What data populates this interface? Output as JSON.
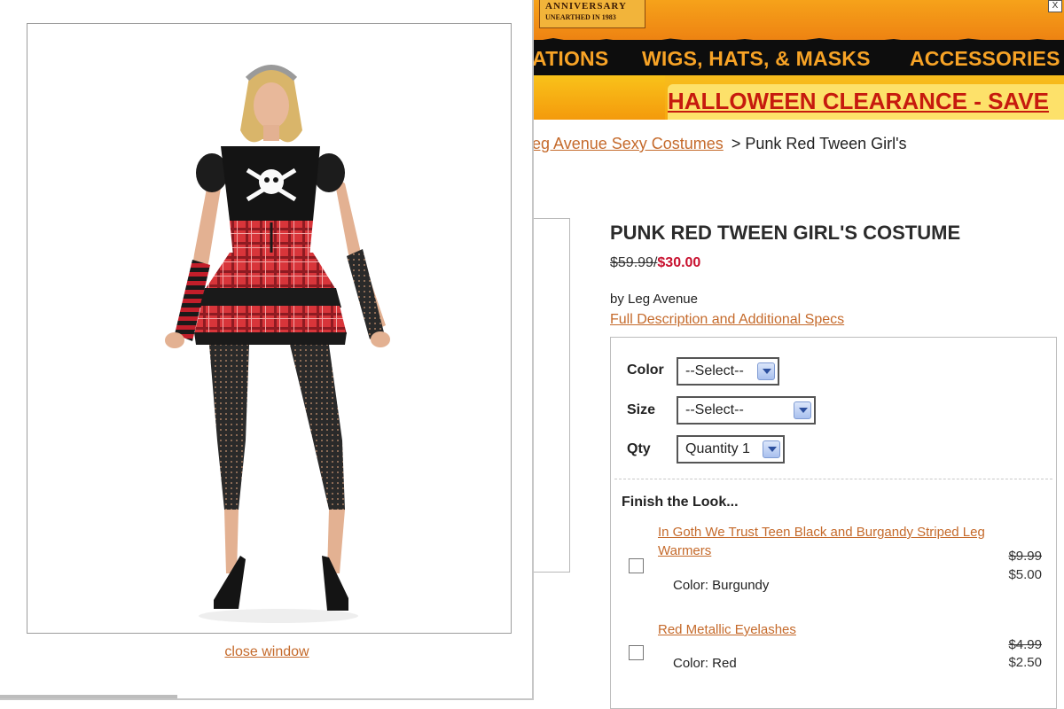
{
  "header": {
    "logo_line1": "ANNIVERSARY",
    "logo_line2": "UNEARTHED IN 1983",
    "close_glyph": "X"
  },
  "nav": {
    "items": [
      "ATIONS",
      "WIGS, HATS, & MASKS",
      "ACCESSORIES"
    ]
  },
  "banner": {
    "text": "HALLOWEEN CLEARANCE - SAVE"
  },
  "breadcrumb": {
    "link": "Leg Avenue Sexy Costumes",
    "separator": ">",
    "current": "Punk Red Tween Girl's"
  },
  "product": {
    "title": "PUNK RED TWEEN GIRL'S COSTUME",
    "old_price": "$59.99/",
    "new_price": "$30.00",
    "brand": "by Leg Avenue",
    "spec_link": "Full Description and Additional Specs"
  },
  "options": {
    "color_label": "Color",
    "color_value": "--Select--",
    "size_label": "Size",
    "size_value": "--Select--",
    "qty_label": "Qty",
    "qty_value": "Quantity 1"
  },
  "finish": {
    "heading": "Finish the Look...",
    "items": [
      {
        "name": "In Goth We Trust Teen Black and Burgandy Striped Leg Warmers",
        "color": "Color: Burgundy",
        "old_price": "$9.99",
        "new_price": "$5.00"
      },
      {
        "name": "Red Metallic Eyelashes",
        "color": "Color: Red",
        "old_price": "$4.99",
        "new_price": "$2.50"
      }
    ]
  },
  "popup": {
    "close_link": "close window"
  },
  "colors": {
    "nav_bg": "#0d0d0d",
    "nav_text": "#f7a326",
    "banner_text": "#c61a0e",
    "link": "#c56a2b",
    "sale_price": "#c8102e"
  }
}
